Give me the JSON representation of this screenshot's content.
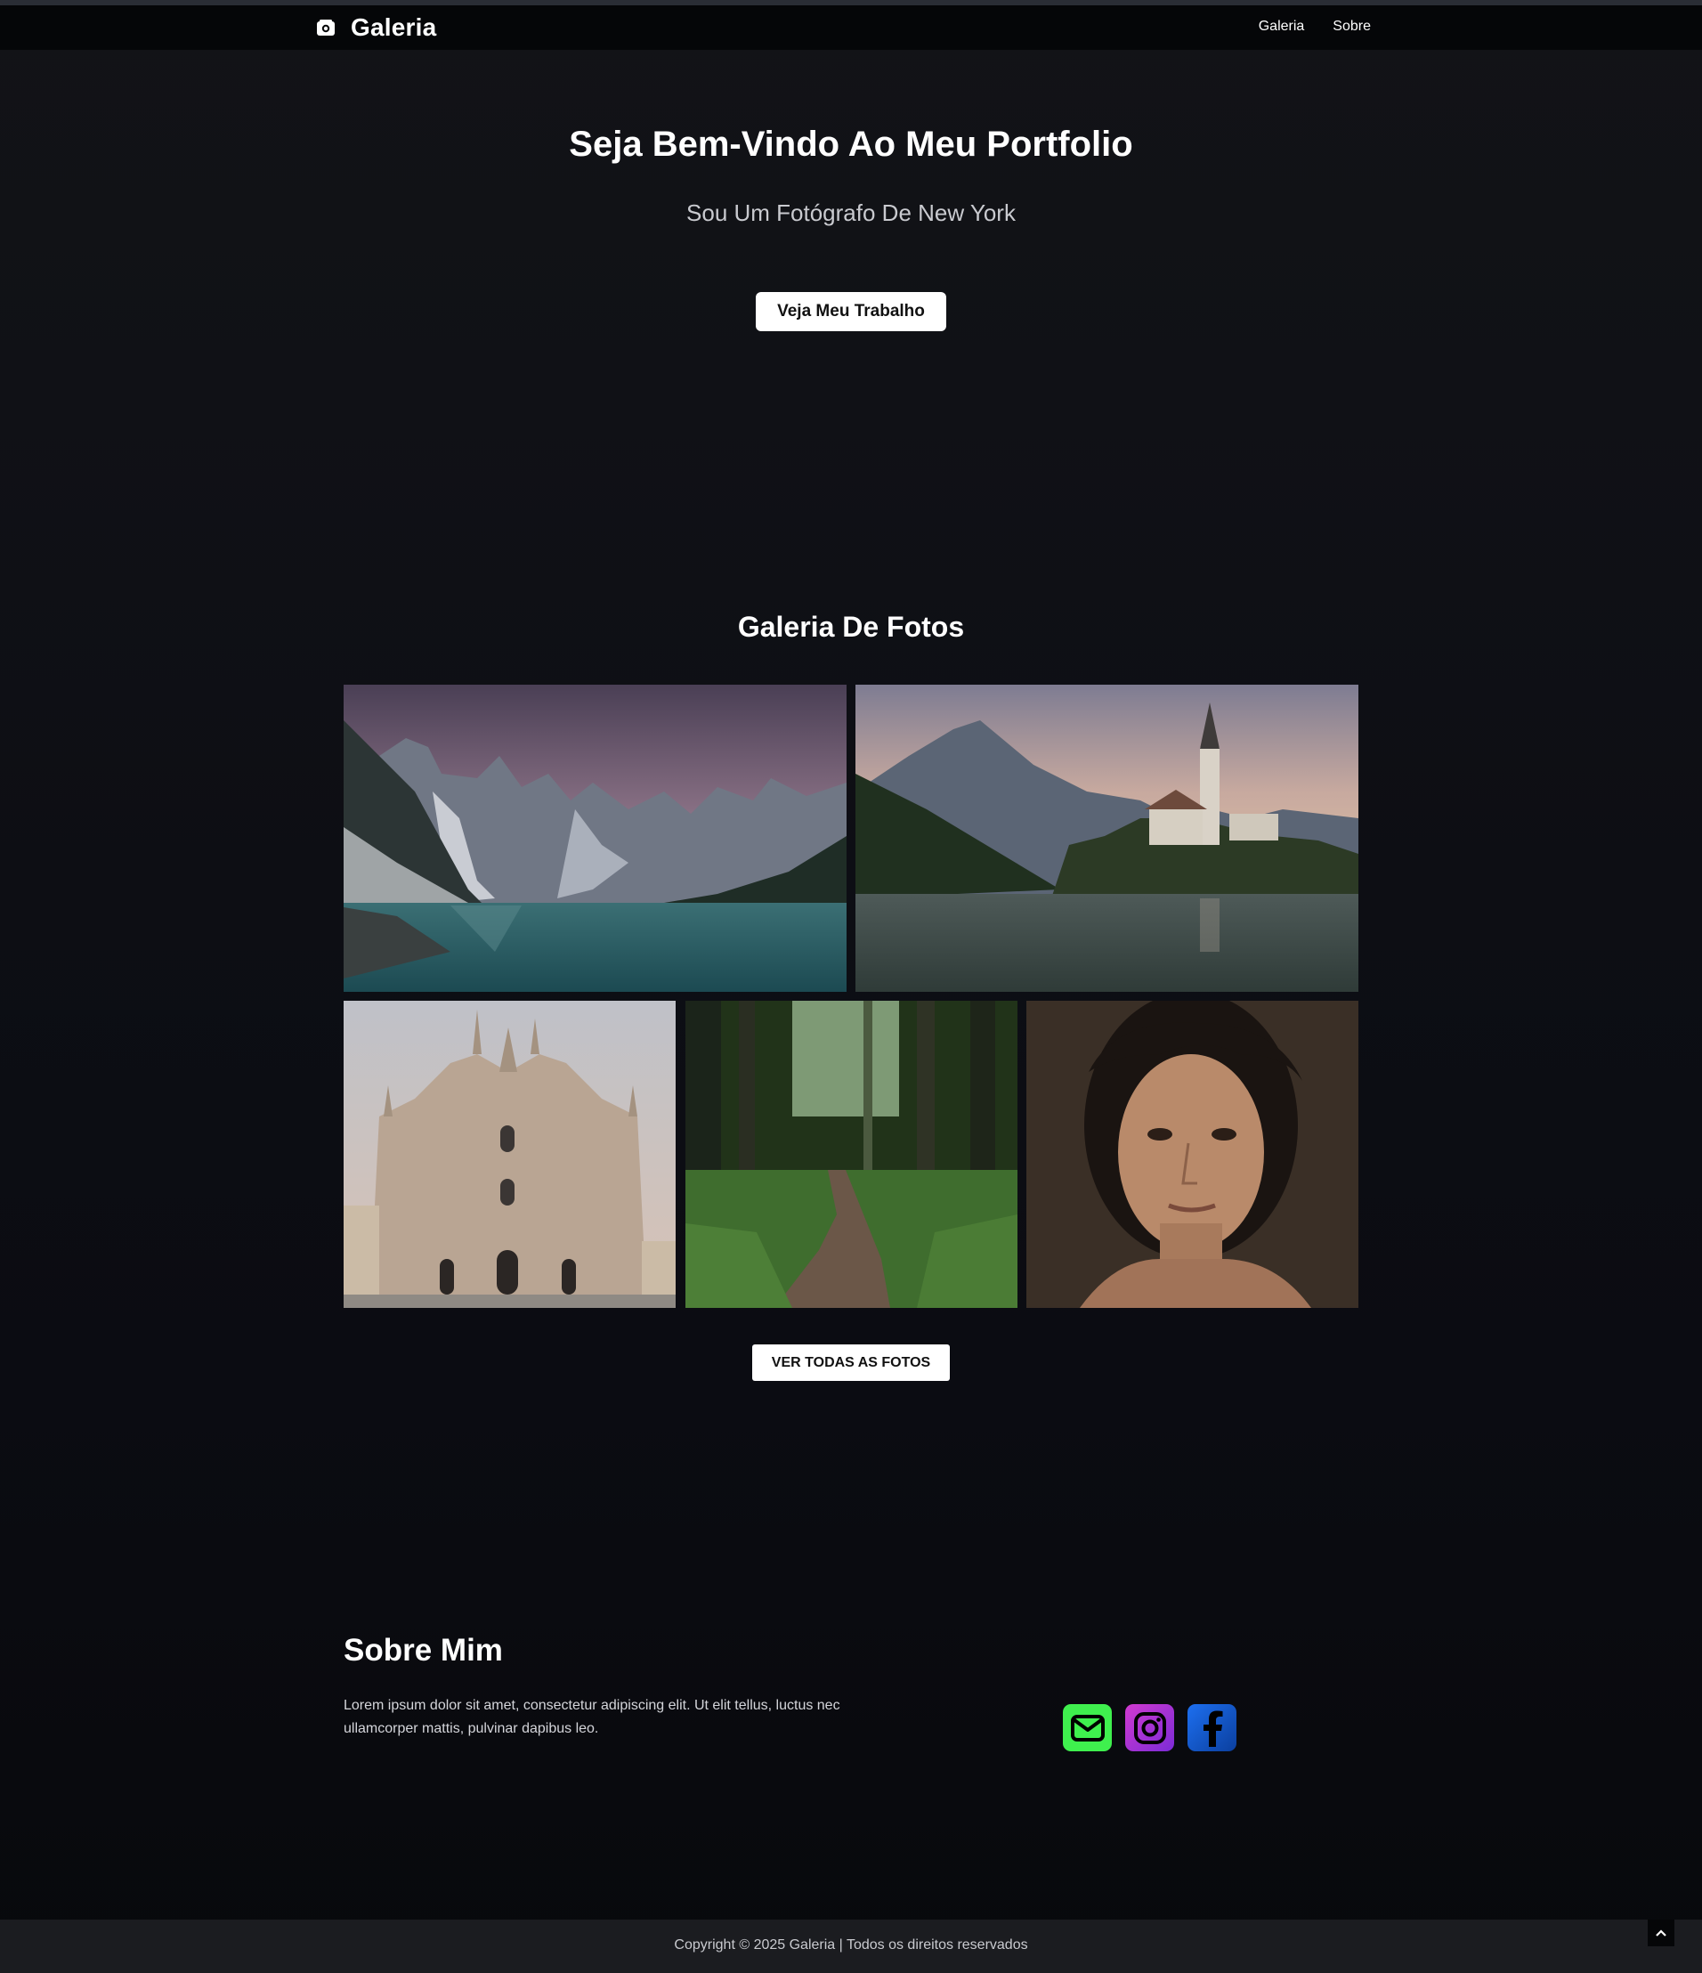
{
  "navbar": {
    "brand": "Galeria",
    "links": [
      "Galeria",
      "Sobre"
    ],
    "icon": "camera-icon"
  },
  "hero": {
    "title": "Seja Bem-Vindo Ao Meu Portfolio",
    "subtitle": "Sou Um Fotógrafo De New York",
    "button": "Veja Meu Trabalho"
  },
  "gallery": {
    "title": "Galeria De Fotos",
    "button": "VER TODAS AS FOTOS"
  },
  "about": {
    "title": "Sobre Mim",
    "text": "Lorem ipsum dolor sit amet, consectetur adipiscing elit. Ut elit tellus, luctus nec ullamcorper mattis, pulvinar dapibus leo.",
    "social": [
      {
        "icon": "mail-icon",
        "color": "#3ff04e"
      },
      {
        "icon": "instagram-icon",
        "color": "#9b33d4"
      },
      {
        "icon": "facebook-icon",
        "color": "#1d6ff0"
      }
    ]
  },
  "footer": {
    "text": "Copyright © 2025 Galeria | Todos os direitos reservados"
  }
}
